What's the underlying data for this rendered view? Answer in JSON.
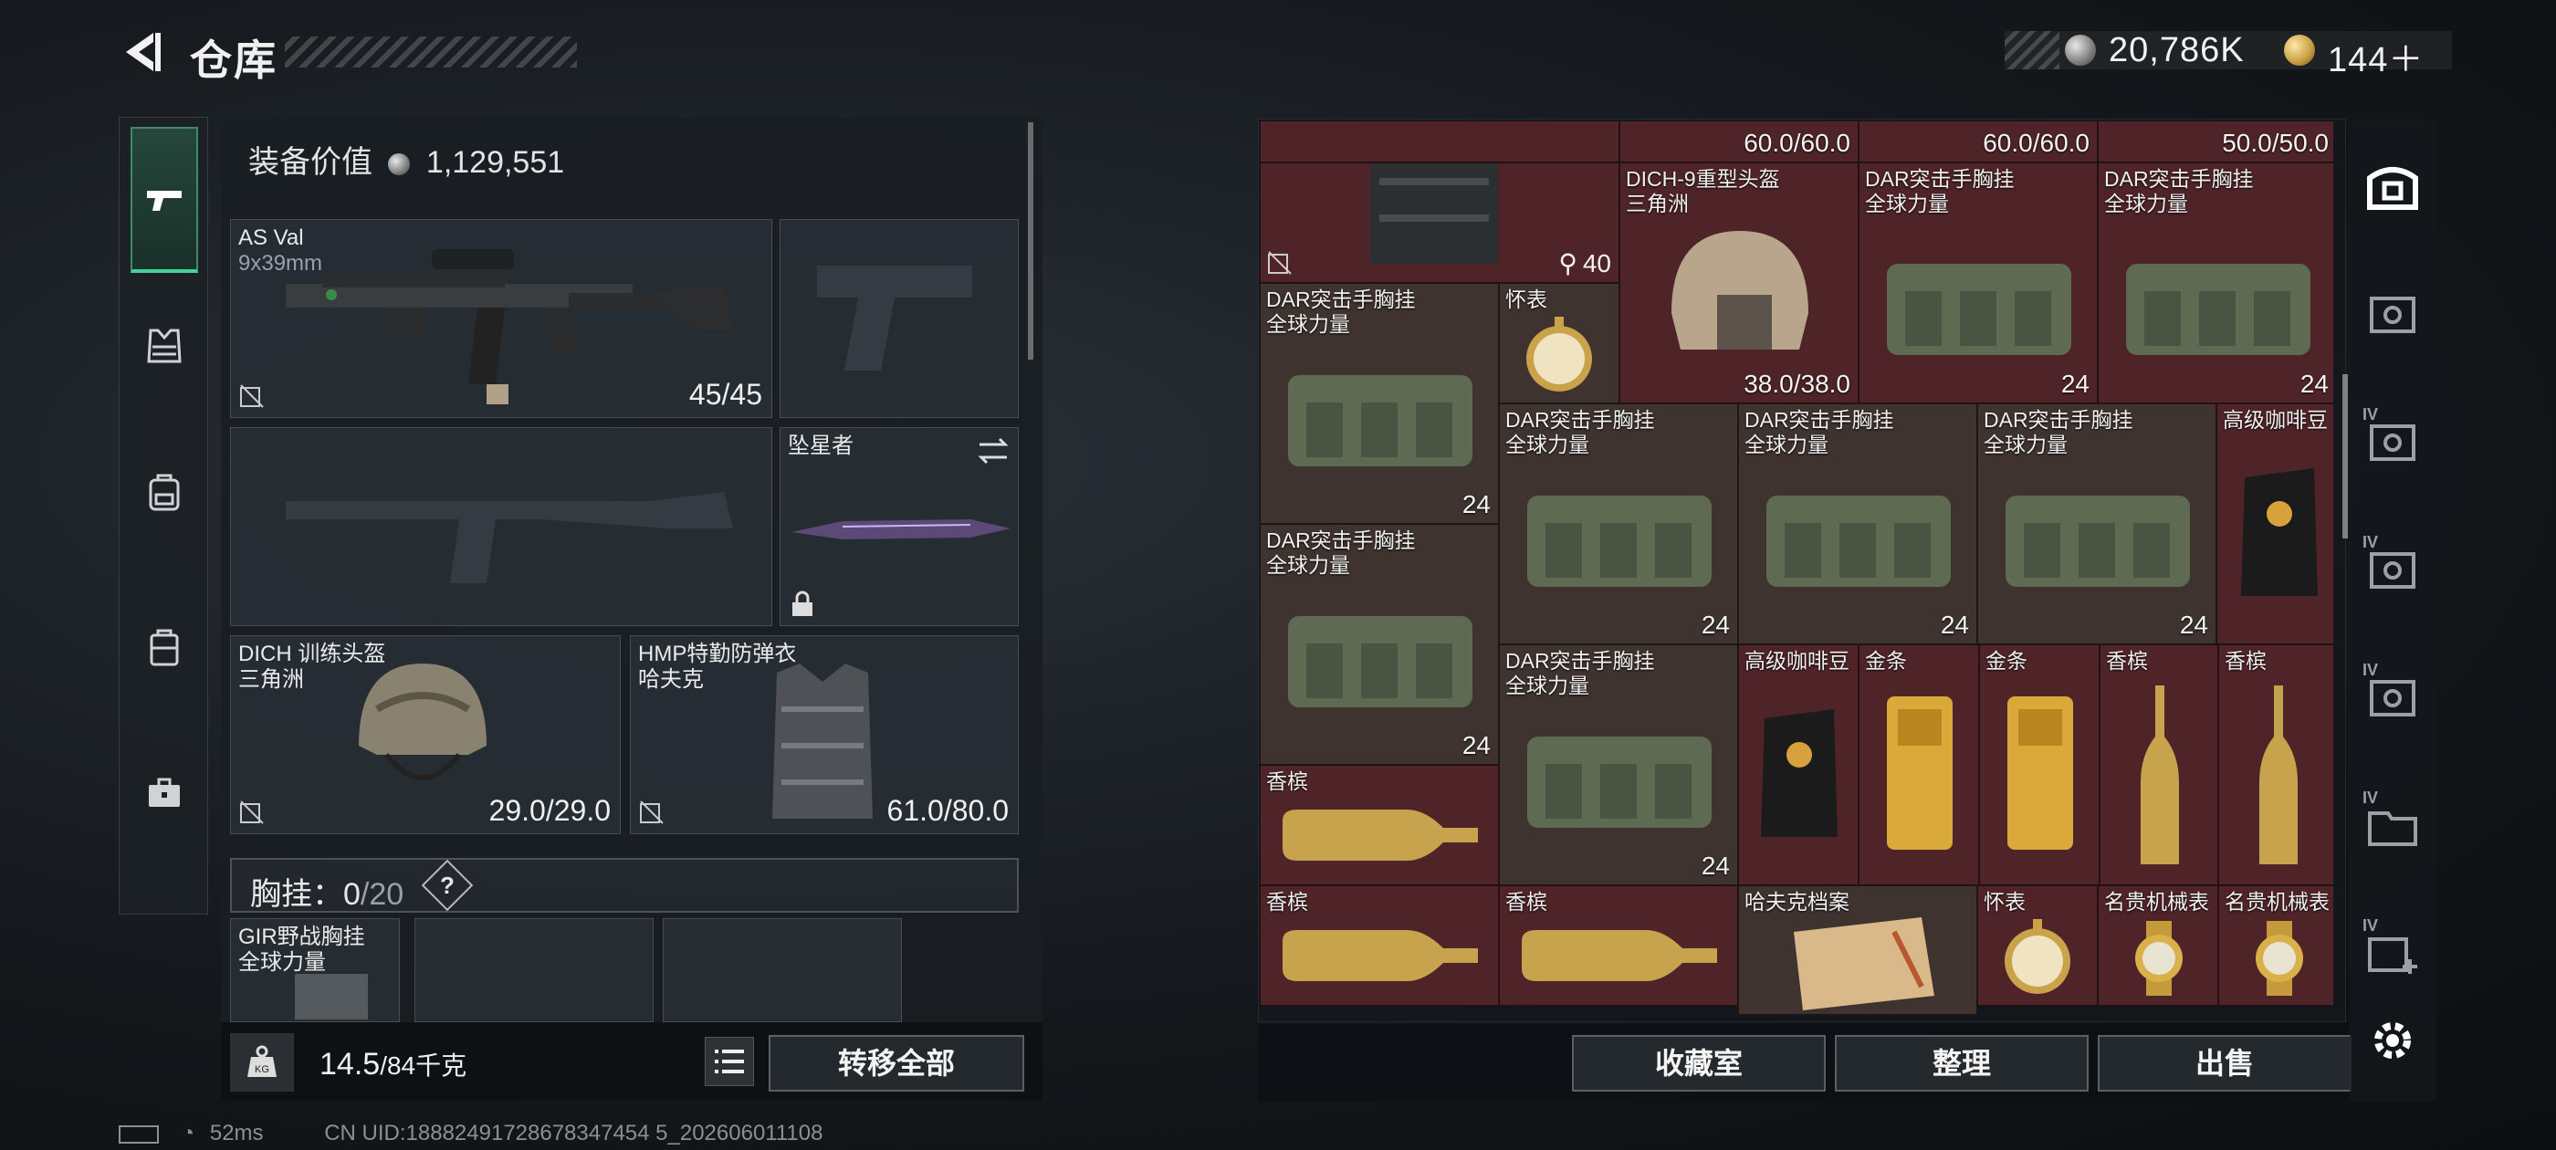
{
  "header": {
    "title": "仓库",
    "silver_amount": "20,786K",
    "gold_amount": "144＋"
  },
  "left_nav": {
    "items": [
      "weapon-icon",
      "armor-icon",
      "backpack-icon",
      "bag-icon",
      "briefcase-icon"
    ],
    "active": 0
  },
  "equipment": {
    "value_label": "装备价值",
    "value": "1,129,551",
    "primary_weapon": {
      "name": "AS Val",
      "caliber": "9x39mm",
      "ammo": "45/45"
    },
    "melee": {
      "name": "坠星者"
    },
    "helmet": {
      "name": "DICH 训练头盔",
      "faction": "三角洲",
      "durability": "29.0/29.0"
    },
    "armor": {
      "name": "HMP特勤防弹衣",
      "faction": "哈夫克",
      "durability": "61.0/80.0"
    },
    "rig": {
      "label": "胸挂：",
      "used": "0",
      "capacity": "/20",
      "help": "?"
    },
    "rig_item": {
      "name": "GIR野战胸挂",
      "faction": "全球力量"
    }
  },
  "footer": {
    "weight_current": "14.5",
    "weight_max": "/84千克",
    "kg_label": "KG",
    "transfer_all": "转移全部"
  },
  "status": {
    "ping": "52ms",
    "uid": "CN UID:18882491728678347454 5_202606011108"
  },
  "stash": {
    "top_durabilities": [
      "60.0/60.0",
      "60.0/60.0",
      "50.0/50.0"
    ],
    "cells": [
      {
        "id": "vest-top",
        "label": "",
        "count": "40"
      },
      {
        "id": "dich9",
        "label": "DICH-9重型头盔\n三角洲",
        "count": "38.0/38.0"
      },
      {
        "id": "dar1",
        "label": "DAR突击手胸挂\n全球力量",
        "count": "24"
      },
      {
        "id": "dar2",
        "label": "DAR突击手胸挂\n全球力量",
        "count": "24"
      },
      {
        "id": "dar3",
        "label": "DAR突击手胸挂\n全球力量",
        "count": "24"
      },
      {
        "id": "watch1",
        "label": "怀表",
        "count": ""
      },
      {
        "id": "dar4",
        "label": "DAR突击手胸挂\n全球力量",
        "count": "24"
      },
      {
        "id": "dar5",
        "label": "DAR突击手胸挂\n全球力量",
        "count": "24"
      },
      {
        "id": "dar6",
        "label": "DAR突击手胸挂\n全球力量",
        "count": "24"
      },
      {
        "id": "coffee1",
        "label": "高级咖啡豆",
        "count": ""
      },
      {
        "id": "dar7",
        "label": "DAR突击手胸挂\n全球力量",
        "count": "24"
      },
      {
        "id": "dar8",
        "label": "DAR突击手胸挂\n全球力量",
        "count": "24"
      },
      {
        "id": "coffee2",
        "label": "高级咖啡豆",
        "count": ""
      },
      {
        "id": "gold1",
        "label": "金条",
        "count": ""
      },
      {
        "id": "gold2",
        "label": "金条",
        "count": ""
      },
      {
        "id": "champ1",
        "label": "香槟",
        "count": ""
      },
      {
        "id": "champ2",
        "label": "香槟",
        "count": ""
      },
      {
        "id": "champ3",
        "label": "香槟",
        "count": ""
      },
      {
        "id": "champ4",
        "label": "香槟",
        "count": ""
      },
      {
        "id": "champ5",
        "label": "香槟",
        "count": ""
      },
      {
        "id": "harvard",
        "label": "哈夫克档案",
        "count": ""
      },
      {
        "id": "watch2",
        "label": "怀表",
        "count": ""
      },
      {
        "id": "mwatch1",
        "label": "名贵机械表",
        "count": ""
      },
      {
        "id": "mwatch2",
        "label": "名贵机械表",
        "count": ""
      }
    ],
    "buttons": {
      "collection": "收藏室",
      "sort": "整理",
      "sell": "出售"
    }
  },
  "filters": {
    "tag": "IV"
  },
  "colors": {
    "cell_red": "#4f2428",
    "cell_brown": "#3f3330",
    "accent_green": "#45d39a"
  }
}
